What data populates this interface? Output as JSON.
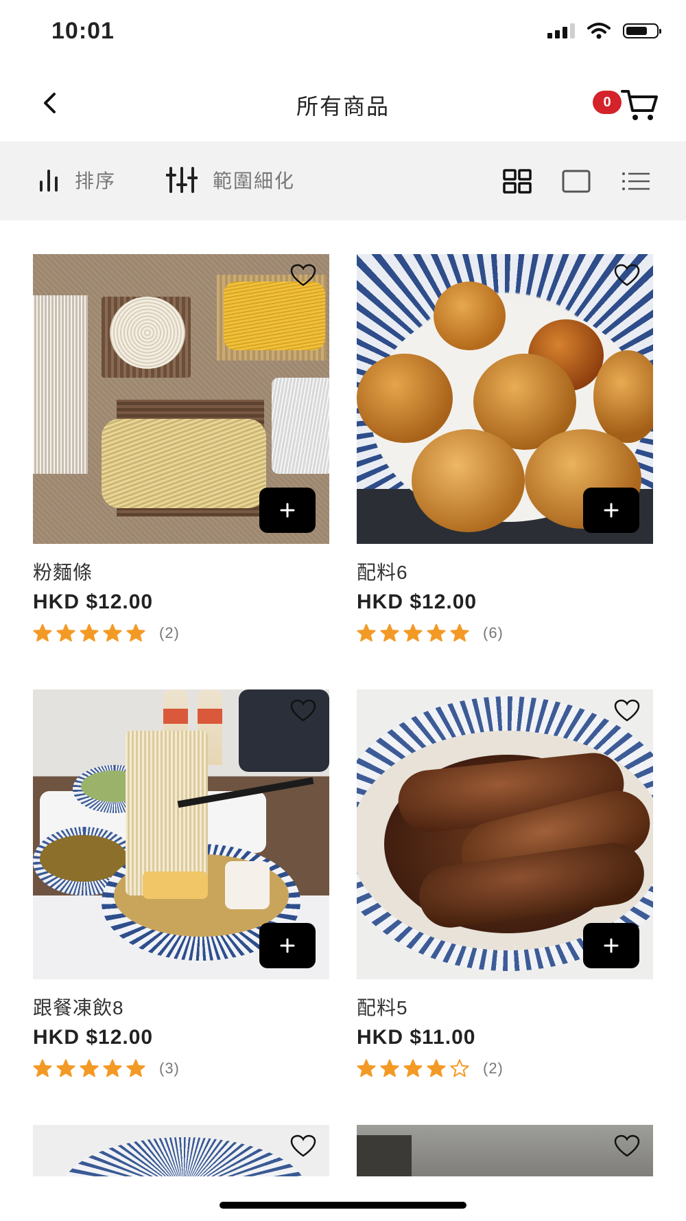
{
  "status_bar": {
    "time": "10:01"
  },
  "header": {
    "title": "所有商品",
    "cart_count": "0"
  },
  "toolbar": {
    "sort_label": "排序",
    "filter_label": "範圍細化"
  },
  "products": [
    {
      "name": "粉麵條",
      "price": "HKD $12.00",
      "rating": 5,
      "review_count": "(2)"
    },
    {
      "name": "配料6",
      "price": "HKD $12.00",
      "rating": 5,
      "review_count": "(6)"
    },
    {
      "name": "跟餐凍飲8",
      "price": "HKD $12.00",
      "rating": 5,
      "review_count": "(3)"
    },
    {
      "name": "配料5",
      "price": "HKD $11.00",
      "rating": 4,
      "review_count": "(2)"
    }
  ],
  "colors": {
    "accent_star": "#f39a26",
    "badge": "#d4232a",
    "toolbar_bg": "#f2f2f2"
  }
}
